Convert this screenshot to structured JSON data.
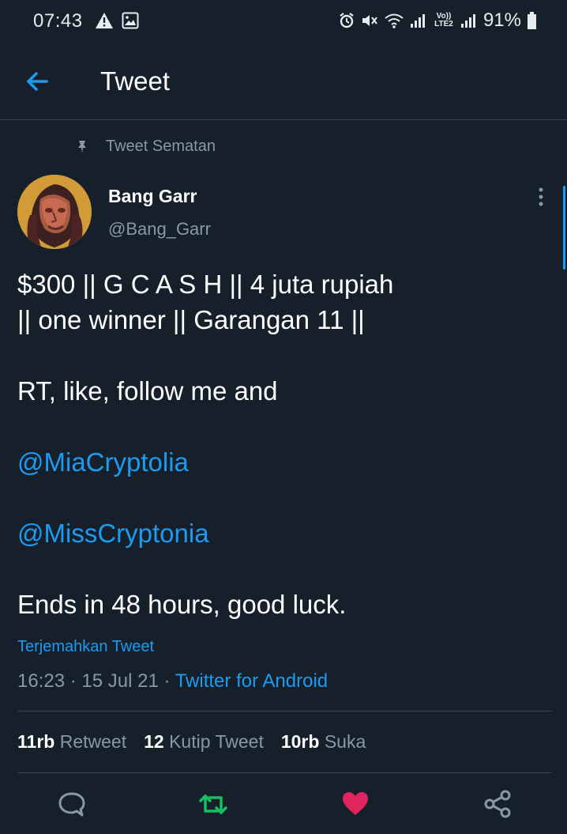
{
  "status": {
    "time": "07:43",
    "battery": "91%",
    "network_label_top": "Vo))",
    "network_label_bottom": "LTE2"
  },
  "header": {
    "title": "Tweet",
    "back_icon": "arrow-left-icon"
  },
  "tweet": {
    "pinned_label": "Tweet Sematan",
    "author": {
      "name": "Bang Garr",
      "handle": "@Bang_Garr"
    },
    "lines": [
      "$300 || G C A S H || 4 juta rupiah",
      "|| one winner || Garangan 11 ||",
      "RT, like, follow me and",
      "@MiaCryptolia",
      "@MissCryptonia",
      "Ends in 48 hours, good luck."
    ],
    "translate": "Terjemahkan Tweet",
    "time": "16:23",
    "date": "15 Jul 21",
    "source": "Twitter for Android",
    "separator": "·"
  },
  "stats": {
    "retweets": {
      "count": "11rb",
      "label": "Retweet"
    },
    "quotes": {
      "count": "12",
      "label": "Kutip Tweet"
    },
    "likes": {
      "count": "10rb",
      "label": "Suka"
    }
  },
  "actions": [
    "reply-icon",
    "retweet-icon",
    "like-icon",
    "share-icon"
  ],
  "colors": {
    "background": "#15202b",
    "accent": "#1d9bf0",
    "retweet": "#17bf63",
    "like": "#e0245e",
    "secondary": "#8899a6"
  }
}
